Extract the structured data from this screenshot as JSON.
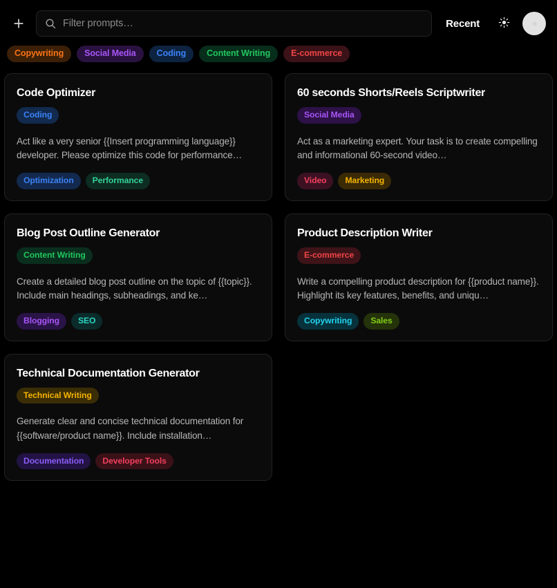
{
  "topbar": {
    "new_prompt_label": "+",
    "new_prompt_icon": "plus-icon",
    "search": {
      "icon": "search-icon",
      "placeholder": "Filter prompts…",
      "value": ""
    },
    "sort_label": "Recent",
    "theme_icon": "sun-icon",
    "avatar_icon": "user-avatar"
  },
  "filters": [
    {
      "label": "Copywriting",
      "bg": "#3b2007",
      "fg": "#f97316"
    },
    {
      "label": "Social Media",
      "bg": "#2a1240",
      "fg": "#a855f7"
    },
    {
      "label": "Coding",
      "bg": "#0d2340",
      "fg": "#3b82f6"
    },
    {
      "label": "Content Writing",
      "bg": "#072d1b",
      "fg": "#22c55e"
    },
    {
      "label": "E-commerce",
      "bg": "#3a1218",
      "fg": "#ef4444"
    }
  ],
  "cards": [
    {
      "title": "Code Optimizer",
      "category": {
        "label": "Coding",
        "bg": "#112a4d",
        "fg": "#3b82f6"
      },
      "description": "Act like a very senior {{Insert programming language}} developer. Please optimize this code for performance…",
      "tags": [
        {
          "label": "Optimization",
          "bg": "#13294d",
          "fg": "#3b82f6"
        },
        {
          "label": "Performance",
          "bg": "#0d2c22",
          "fg": "#34d399"
        }
      ]
    },
    {
      "title": "60 seconds Shorts/Reels Scriptwriter",
      "category": {
        "label": "Social Media",
        "bg": "#2d1147",
        "fg": "#a855f7"
      },
      "description": "Act as a marketing expert. Your task is to create compelling and informational 60-second video…",
      "tags": [
        {
          "label": "Video",
          "bg": "#3c1222",
          "fg": "#f43f5e"
        },
        {
          "label": "Marketing",
          "bg": "#3a2a05",
          "fg": "#f5b400"
        }
      ]
    },
    {
      "title": "Blog Post Outline Generator",
      "category": {
        "label": "Content Writing",
        "bg": "#0a2e1d",
        "fg": "#22c55e"
      },
      "description": "Create a detailed blog post outline on the topic of {{topic}}. Include main headings, subheadings, and ke…",
      "tags": [
        {
          "label": "Blogging",
          "bg": "#2a1347",
          "fg": "#a855f7"
        },
        {
          "label": "SEO",
          "bg": "#0b2b2b",
          "fg": "#2dd4bf"
        }
      ]
    },
    {
      "title": "Product Description Writer",
      "category": {
        "label": "E-commerce",
        "bg": "#3e1419",
        "fg": "#ef4444"
      },
      "description": "Write a compelling product description for {{product name}}. Highlight its key features, benefits, and uniqu…",
      "tags": [
        {
          "label": "Copywriting",
          "bg": "#07323c",
          "fg": "#22d3ee"
        },
        {
          "label": "Sales",
          "bg": "#24330a",
          "fg": "#84cc16"
        }
      ]
    },
    {
      "title": "Technical Documentation Generator",
      "category": {
        "label": "Technical Writing",
        "bg": "#3b2d05",
        "fg": "#f5b400"
      },
      "description": "Generate clear and concise technical documentation for {{software/product name}}. Include installation…",
      "tags": [
        {
          "label": "Documentation",
          "bg": "#221344",
          "fg": "#8b5cf6"
        },
        {
          "label": "Developer Tools",
          "bg": "#3a1117",
          "fg": "#f43f5e"
        }
      ]
    }
  ]
}
